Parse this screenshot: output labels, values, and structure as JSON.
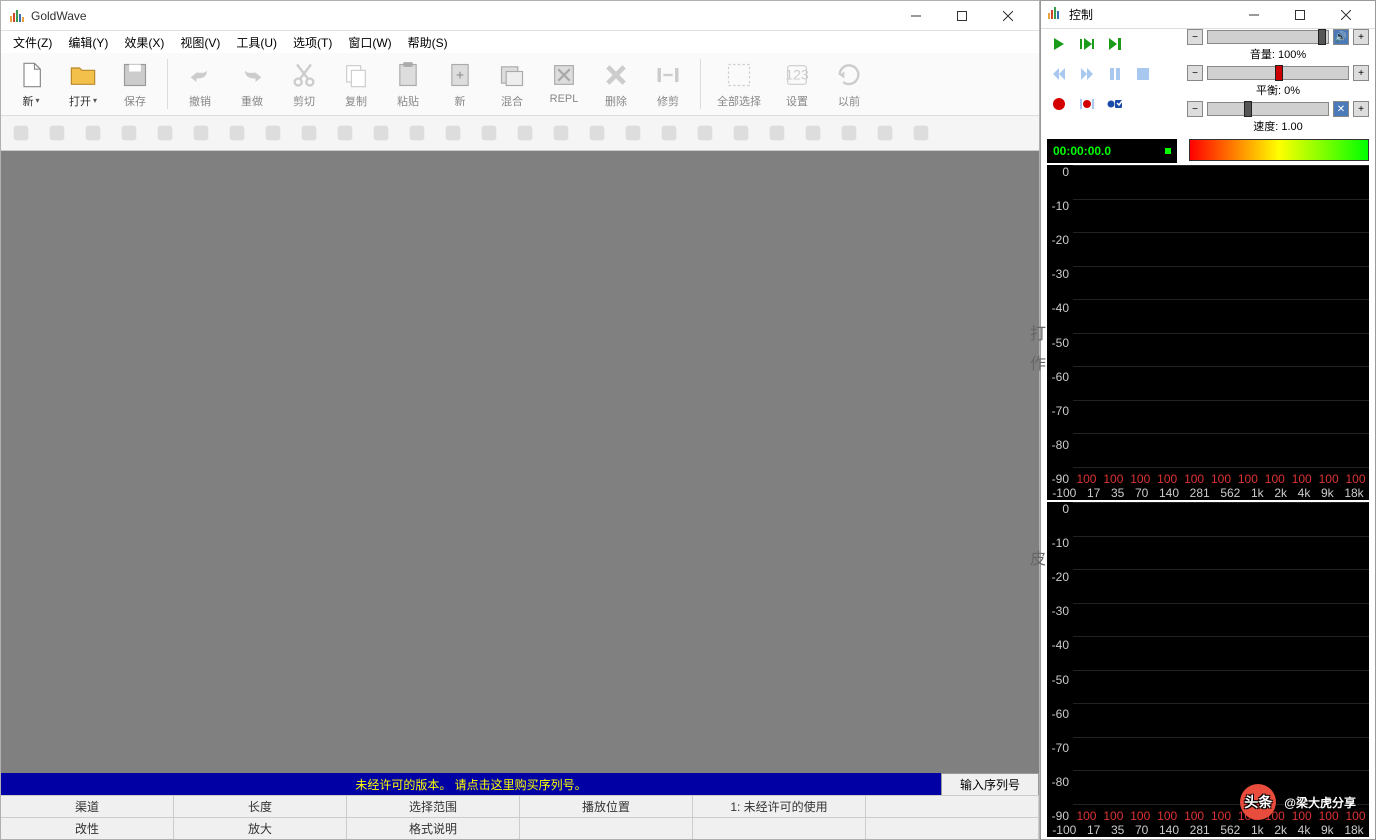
{
  "main": {
    "title": "GoldWave",
    "menu": [
      "文件(Z)",
      "编辑(Y)",
      "效果(X)",
      "视图(V)",
      "工具(U)",
      "选项(T)",
      "窗口(W)",
      "帮助(S)"
    ],
    "toolbar": [
      {
        "label": "新",
        "icon": "file-new",
        "enabled": true,
        "dropdown": true
      },
      {
        "label": "打开",
        "icon": "folder-open",
        "enabled": true,
        "dropdown": true
      },
      {
        "label": "保存",
        "icon": "save",
        "enabled": false
      },
      {
        "sep": true
      },
      {
        "label": "撤销",
        "icon": "undo",
        "enabled": false
      },
      {
        "label": "重做",
        "icon": "redo",
        "enabled": false
      },
      {
        "label": "剪切",
        "icon": "cut",
        "enabled": false
      },
      {
        "label": "复制",
        "icon": "copy",
        "enabled": false
      },
      {
        "label": "粘贴",
        "icon": "paste",
        "enabled": false
      },
      {
        "label": "新",
        "icon": "paste-new",
        "enabled": false
      },
      {
        "label": "混合",
        "icon": "mix",
        "enabled": false
      },
      {
        "label": "REPL",
        "icon": "replace",
        "enabled": false
      },
      {
        "label": "删除",
        "icon": "delete",
        "enabled": false
      },
      {
        "label": "修剪",
        "icon": "trim",
        "enabled": false
      },
      {
        "sep": true
      },
      {
        "label": "全部选择",
        "icon": "select-all",
        "enabled": false
      },
      {
        "label": "设置",
        "icon": "set-marker",
        "enabled": false
      },
      {
        "label": "以前",
        "icon": "previous",
        "enabled": false
      }
    ],
    "license_msg": "未经许可的版本。 请点击这里购买序列号。",
    "serial_btn": "输入序列号",
    "status1": [
      "渠道",
      "长度",
      "选择范围",
      "播放位置",
      "1: 未经许可的使用",
      ""
    ],
    "status2": [
      "改性",
      "放大",
      "格式说明",
      "",
      "",
      ""
    ]
  },
  "ctrl": {
    "title": "控制",
    "volume_label": "音量: 100%",
    "balance_label": "平衡: 0%",
    "speed_label": "速度: 1.00",
    "time": "00:00:00.0",
    "y_ticks": [
      "0",
      "-10",
      "-20",
      "-30",
      "-40",
      "-50",
      "-60",
      "-70",
      "-80",
      "-90"
    ],
    "x_100": [
      "100",
      "100",
      "100",
      "100",
      "100",
      "100",
      "100",
      "100",
      "100",
      "100",
      "100"
    ],
    "x_freq": [
      "-100",
      "17",
      "35",
      "70",
      "140",
      "281",
      "562",
      "1k",
      "2k",
      "4k",
      "9k",
      "18k"
    ]
  },
  "bg_chars": [
    "打",
    "作",
    "皮"
  ],
  "watermark": {
    "brand": "头条",
    "author": "@梁大虎分享"
  }
}
